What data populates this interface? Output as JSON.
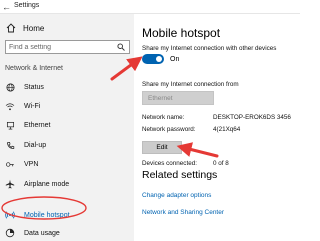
{
  "window": {
    "title": "Settings",
    "back_icon": "back-arrow-icon"
  },
  "sidebar": {
    "home_label": "Home",
    "search_placeholder": "Find a setting",
    "section_label": "Network & Internet",
    "items": [
      {
        "label": "Status",
        "icon": "globe-icon",
        "active": false
      },
      {
        "label": "Wi-Fi",
        "icon": "wifi-icon",
        "active": false
      },
      {
        "label": "Ethernet",
        "icon": "ethernet-icon",
        "active": false
      },
      {
        "label": "Dial-up",
        "icon": "phone-icon",
        "active": false
      },
      {
        "label": "VPN",
        "icon": "vpn-icon",
        "active": false
      },
      {
        "label": "Airplane mode",
        "icon": "airplane-icon",
        "active": false
      },
      {
        "label": "Mobile hotspot",
        "icon": "hotspot-icon",
        "active": true
      },
      {
        "label": "Data usage",
        "icon": "data-usage-icon",
        "active": false
      }
    ]
  },
  "main": {
    "title": "Mobile hotspot",
    "share_label": "Share my Internet connection with other devices",
    "toggle_state": "On",
    "from_label": "Share my Internet connection from",
    "from_value": "Ethernet",
    "network_name_label": "Network name:",
    "network_name_value": "DESKTOP-EROK6DS 3456",
    "network_password_label": "Network password:",
    "network_password_value": "4(21Xq64",
    "edit_label": "Edit",
    "devices_label": "Devices connected:",
    "devices_value": "0 of 8",
    "related_title": "Related settings",
    "related_links": [
      "Change adapter options",
      "Network and Sharing Center"
    ]
  },
  "colors": {
    "accent": "#0063b1",
    "annotation": "#e53935",
    "sidebar_bg": "#f2f2f2",
    "disabled_bg": "#cfcfcf"
  }
}
